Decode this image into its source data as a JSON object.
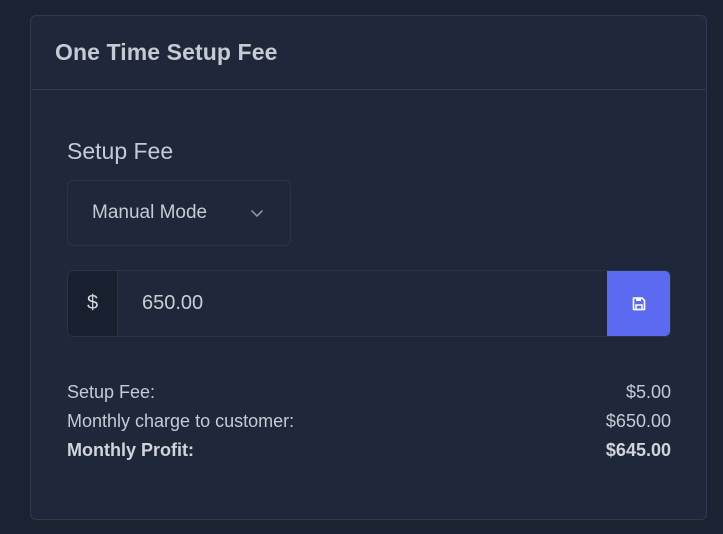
{
  "card": {
    "title": "One Time Setup Fee"
  },
  "setup": {
    "section_title": "Setup Fee",
    "mode_select": {
      "selected": "Manual Mode"
    },
    "amount": {
      "prefix": "$",
      "value": "650.00"
    },
    "save_icon": "floppy-disk-icon"
  },
  "summary": {
    "rows": [
      {
        "label": "Setup Fee:",
        "value": "$5.00"
      },
      {
        "label": "Monthly charge to customer:",
        "value": "$650.00"
      },
      {
        "label": "Monthly Profit:",
        "value": "$645.00"
      }
    ]
  },
  "colors": {
    "page_bg": "#1b2332",
    "card_bg": "#1f283a",
    "accent": "#5b6af0"
  }
}
